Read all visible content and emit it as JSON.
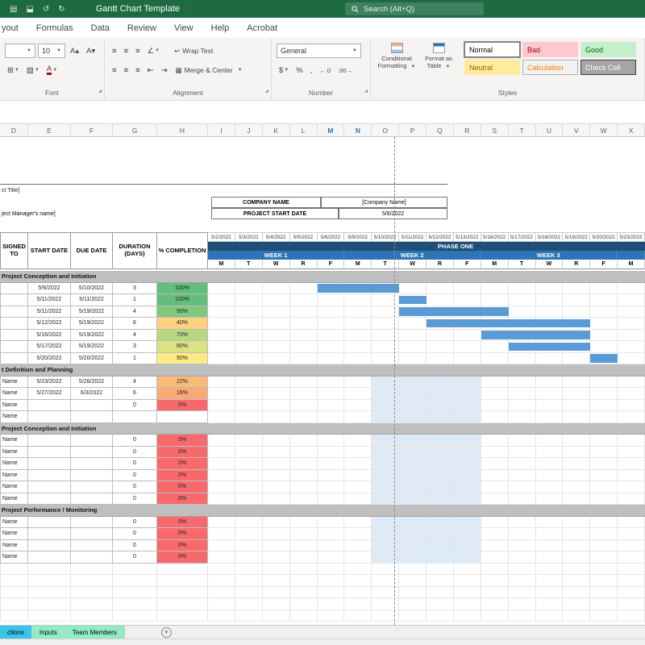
{
  "title_bar": {
    "title": "Gantt Chart Template",
    "search_placeholder": "Search (Alt+Q)"
  },
  "menu": {
    "tabs": [
      "yout",
      "Formulas",
      "Data",
      "Review",
      "View",
      "Help",
      "Acrobat"
    ]
  },
  "ribbon": {
    "font": {
      "label": "Font",
      "size": "10"
    },
    "alignment": {
      "label": "Alignment",
      "wrap_text": "Wrap Text",
      "merge_center": "Merge & Center"
    },
    "number": {
      "label": "Number",
      "format": "General"
    },
    "styles": {
      "label": "Styles",
      "conditional_line1": "Conditional",
      "conditional_line2": "Formatting",
      "format_table_line1": "Format as",
      "format_table_line2": "Table",
      "gallery": [
        {
          "label": "Normal",
          "bg": "#FFFFFF",
          "fg": "#000000",
          "border": "#7C7C7C"
        },
        {
          "label": "Bad",
          "bg": "#FFC7CE",
          "fg": "#9C0006",
          "border": "#FFC7CE"
        },
        {
          "label": "Good",
          "bg": "#C6EFCE",
          "fg": "#006100",
          "border": "#C6EFCE"
        },
        {
          "label": "Neutral",
          "bg": "#FFEB9C",
          "fg": "#9C6500",
          "border": "#FFEB9C"
        },
        {
          "label": "Calculation",
          "bg": "#F2F2F2",
          "fg": "#FA7D00",
          "border": "#B0B0B0"
        },
        {
          "label": "Check Cell",
          "bg": "#A5A5A5",
          "fg": "#FFFFFF",
          "border": "#3F3F3F"
        }
      ]
    }
  },
  "columns": {
    "left": [
      "D",
      "E",
      "F",
      "G",
      "H"
    ],
    "gantt": [
      "I",
      "J",
      "K",
      "L",
      "M",
      "N",
      "O",
      "P",
      "Q",
      "R",
      "S",
      "T",
      "U",
      "V",
      "W",
      "X"
    ],
    "highlighted": [
      "M",
      "N"
    ]
  },
  "info_block": {
    "project_title": "ct Title]",
    "manager": "ject Manager's name]",
    "company_label": "COMPANY NAME",
    "company_value": "[Company Name]",
    "start_label": "PROJECT START DATE",
    "start_value": "5/6/2022"
  },
  "gantt": {
    "dates": [
      "5/2/2022",
      "5/3/2022",
      "5/4/2022",
      "5/5/2022",
      "5/6/2022",
      "5/9/2022",
      "5/10/2022",
      "5/11/2022",
      "5/12/2022",
      "5/13/2022",
      "5/16/2022",
      "5/17/2022",
      "5/18/2022",
      "5/19/2022",
      "5/20/2022",
      "5/23/2022"
    ],
    "phase": "PHASE ONE",
    "weeks": [
      {
        "label": "WEEK 1",
        "span": 5
      },
      {
        "label": "WEEK 2",
        "span": 5
      },
      {
        "label": "WEEK 3",
        "span": 5
      },
      {
        "label": "",
        "span": 1
      }
    ],
    "days": [
      "M",
      "T",
      "W",
      "R",
      "F",
      "M",
      "T",
      "W",
      "R",
      "F",
      "M",
      "T",
      "W",
      "R",
      "F",
      "M"
    ],
    "highlight_range": [
      6,
      9
    ],
    "highlight_color": "#DEEAF6",
    "bar_color": "#5B9BD5"
  },
  "table": {
    "headers": [
      "SIGNED TO",
      "START DATE",
      "DUE DATE",
      "DURATION (DAYS)",
      "% COMPLETION"
    ],
    "sections": [
      {
        "title": "Project Conception and Initiation",
        "highlight": false,
        "rows": [
          {
            "name": "",
            "start": "5/6/2022",
            "due": "5/10/2022",
            "duration": "3",
            "pct": "100%",
            "pct_bg": "#63BE7B",
            "bar": [
              4,
              6
            ]
          },
          {
            "name": "",
            "start": "5/11/2022",
            "due": "5/11/2022",
            "duration": "1",
            "pct": "100%",
            "pct_bg": "#63BE7B",
            "bar": [
              7,
              7
            ]
          },
          {
            "name": "",
            "start": "5/11/2022",
            "due": "5/19/2022",
            "duration": "4",
            "pct": "90%",
            "pct_bg": "#7FC87C",
            "bar": [
              7,
              10
            ]
          },
          {
            "name": "",
            "start": "5/12/2022",
            "due": "5/19/2022",
            "duration": "6",
            "pct": "40%",
            "pct_bg": "#FDD17E",
            "bar": [
              8,
              13
            ]
          },
          {
            "name": "",
            "start": "5/16/2022",
            "due": "5/19/2022",
            "duration": "4",
            "pct": "70%",
            "pct_bg": "#B9D780",
            "bar": [
              10,
              13
            ]
          },
          {
            "name": "",
            "start": "5/17/2022",
            "due": "5/19/2022",
            "duration": "3",
            "pct": "60%",
            "pct_bg": "#DCE182",
            "bar": [
              11,
              13
            ]
          },
          {
            "name": "",
            "start": "5/20/2022",
            "due": "5/20/2022",
            "duration": "1",
            "pct": "50%",
            "pct_bg": "#FFEB84",
            "bar": [
              14,
              14
            ]
          }
        ]
      },
      {
        "title": "t Definition and Planning",
        "highlight": true,
        "rows": [
          {
            "name": "Name",
            "start": "5/23/2022",
            "due": "5/26/2022",
            "duration": "4",
            "pct": "22%",
            "pct_bg": "#FBBA77",
            "bar": null
          },
          {
            "name": "Name",
            "start": "5/27/2022",
            "due": "6/3/2022",
            "duration": "6",
            "pct": "16%",
            "pct_bg": "#FAA876",
            "bar": null
          },
          {
            "name": "Name",
            "start": "",
            "due": "",
            "duration": "0",
            "pct": "0%",
            "pct_bg": "#F8696B",
            "bar": null
          },
          {
            "name": "Name",
            "start": "",
            "due": "",
            "duration": "",
            "pct": "",
            "pct_bg": null,
            "bar": null
          }
        ]
      },
      {
        "title": "Project Conception and Initiation",
        "highlight": true,
        "rows": [
          {
            "name": "Name",
            "start": "",
            "due": "",
            "duration": "0",
            "pct": "0%",
            "pct_bg": "#F8696B",
            "bar": null
          },
          {
            "name": "Name",
            "start": "",
            "due": "",
            "duration": "0",
            "pct": "0%",
            "pct_bg": "#F8696B",
            "bar": null
          },
          {
            "name": "Name",
            "start": "",
            "due": "",
            "duration": "0",
            "pct": "0%",
            "pct_bg": "#F8696B",
            "bar": null
          },
          {
            "name": "Name",
            "start": "",
            "due": "",
            "duration": "0",
            "pct": "0%",
            "pct_bg": "#F8696B",
            "bar": null
          },
          {
            "name": "Name",
            "start": "",
            "due": "",
            "duration": "0",
            "pct": "0%",
            "pct_bg": "#F8696B",
            "bar": null
          },
          {
            "name": "Name",
            "start": "",
            "due": "",
            "duration": "0",
            "pct": "0%",
            "pct_bg": "#F8696B",
            "bar": null
          }
        ]
      },
      {
        "title": "Project Performance / Monitoring",
        "highlight": true,
        "rows": [
          {
            "name": "Name",
            "start": "",
            "due": "",
            "duration": "0",
            "pct": "0%",
            "pct_bg": "#F8696B",
            "bar": null
          },
          {
            "name": "Name",
            "start": "",
            "due": "",
            "duration": "0",
            "pct": "0%",
            "pct_bg": "#F8696B",
            "bar": null
          },
          {
            "name": "Name",
            "start": "",
            "due": "",
            "duration": "0",
            "pct": "0%",
            "pct_bg": "#F8696B",
            "bar": null
          },
          {
            "name": "Name",
            "start": "",
            "due": "",
            "duration": "0",
            "pct": "0%",
            "pct_bg": "#F8696B",
            "bar": null
          }
        ]
      }
    ]
  },
  "sheet_tabs": [
    {
      "label": "ctions",
      "bg": "#3BC3EC"
    },
    {
      "label": "Inputs",
      "bg": "#92EBC8"
    },
    {
      "label": "Team Members",
      "bg": "#92EBC8"
    }
  ],
  "add_button": "+"
}
